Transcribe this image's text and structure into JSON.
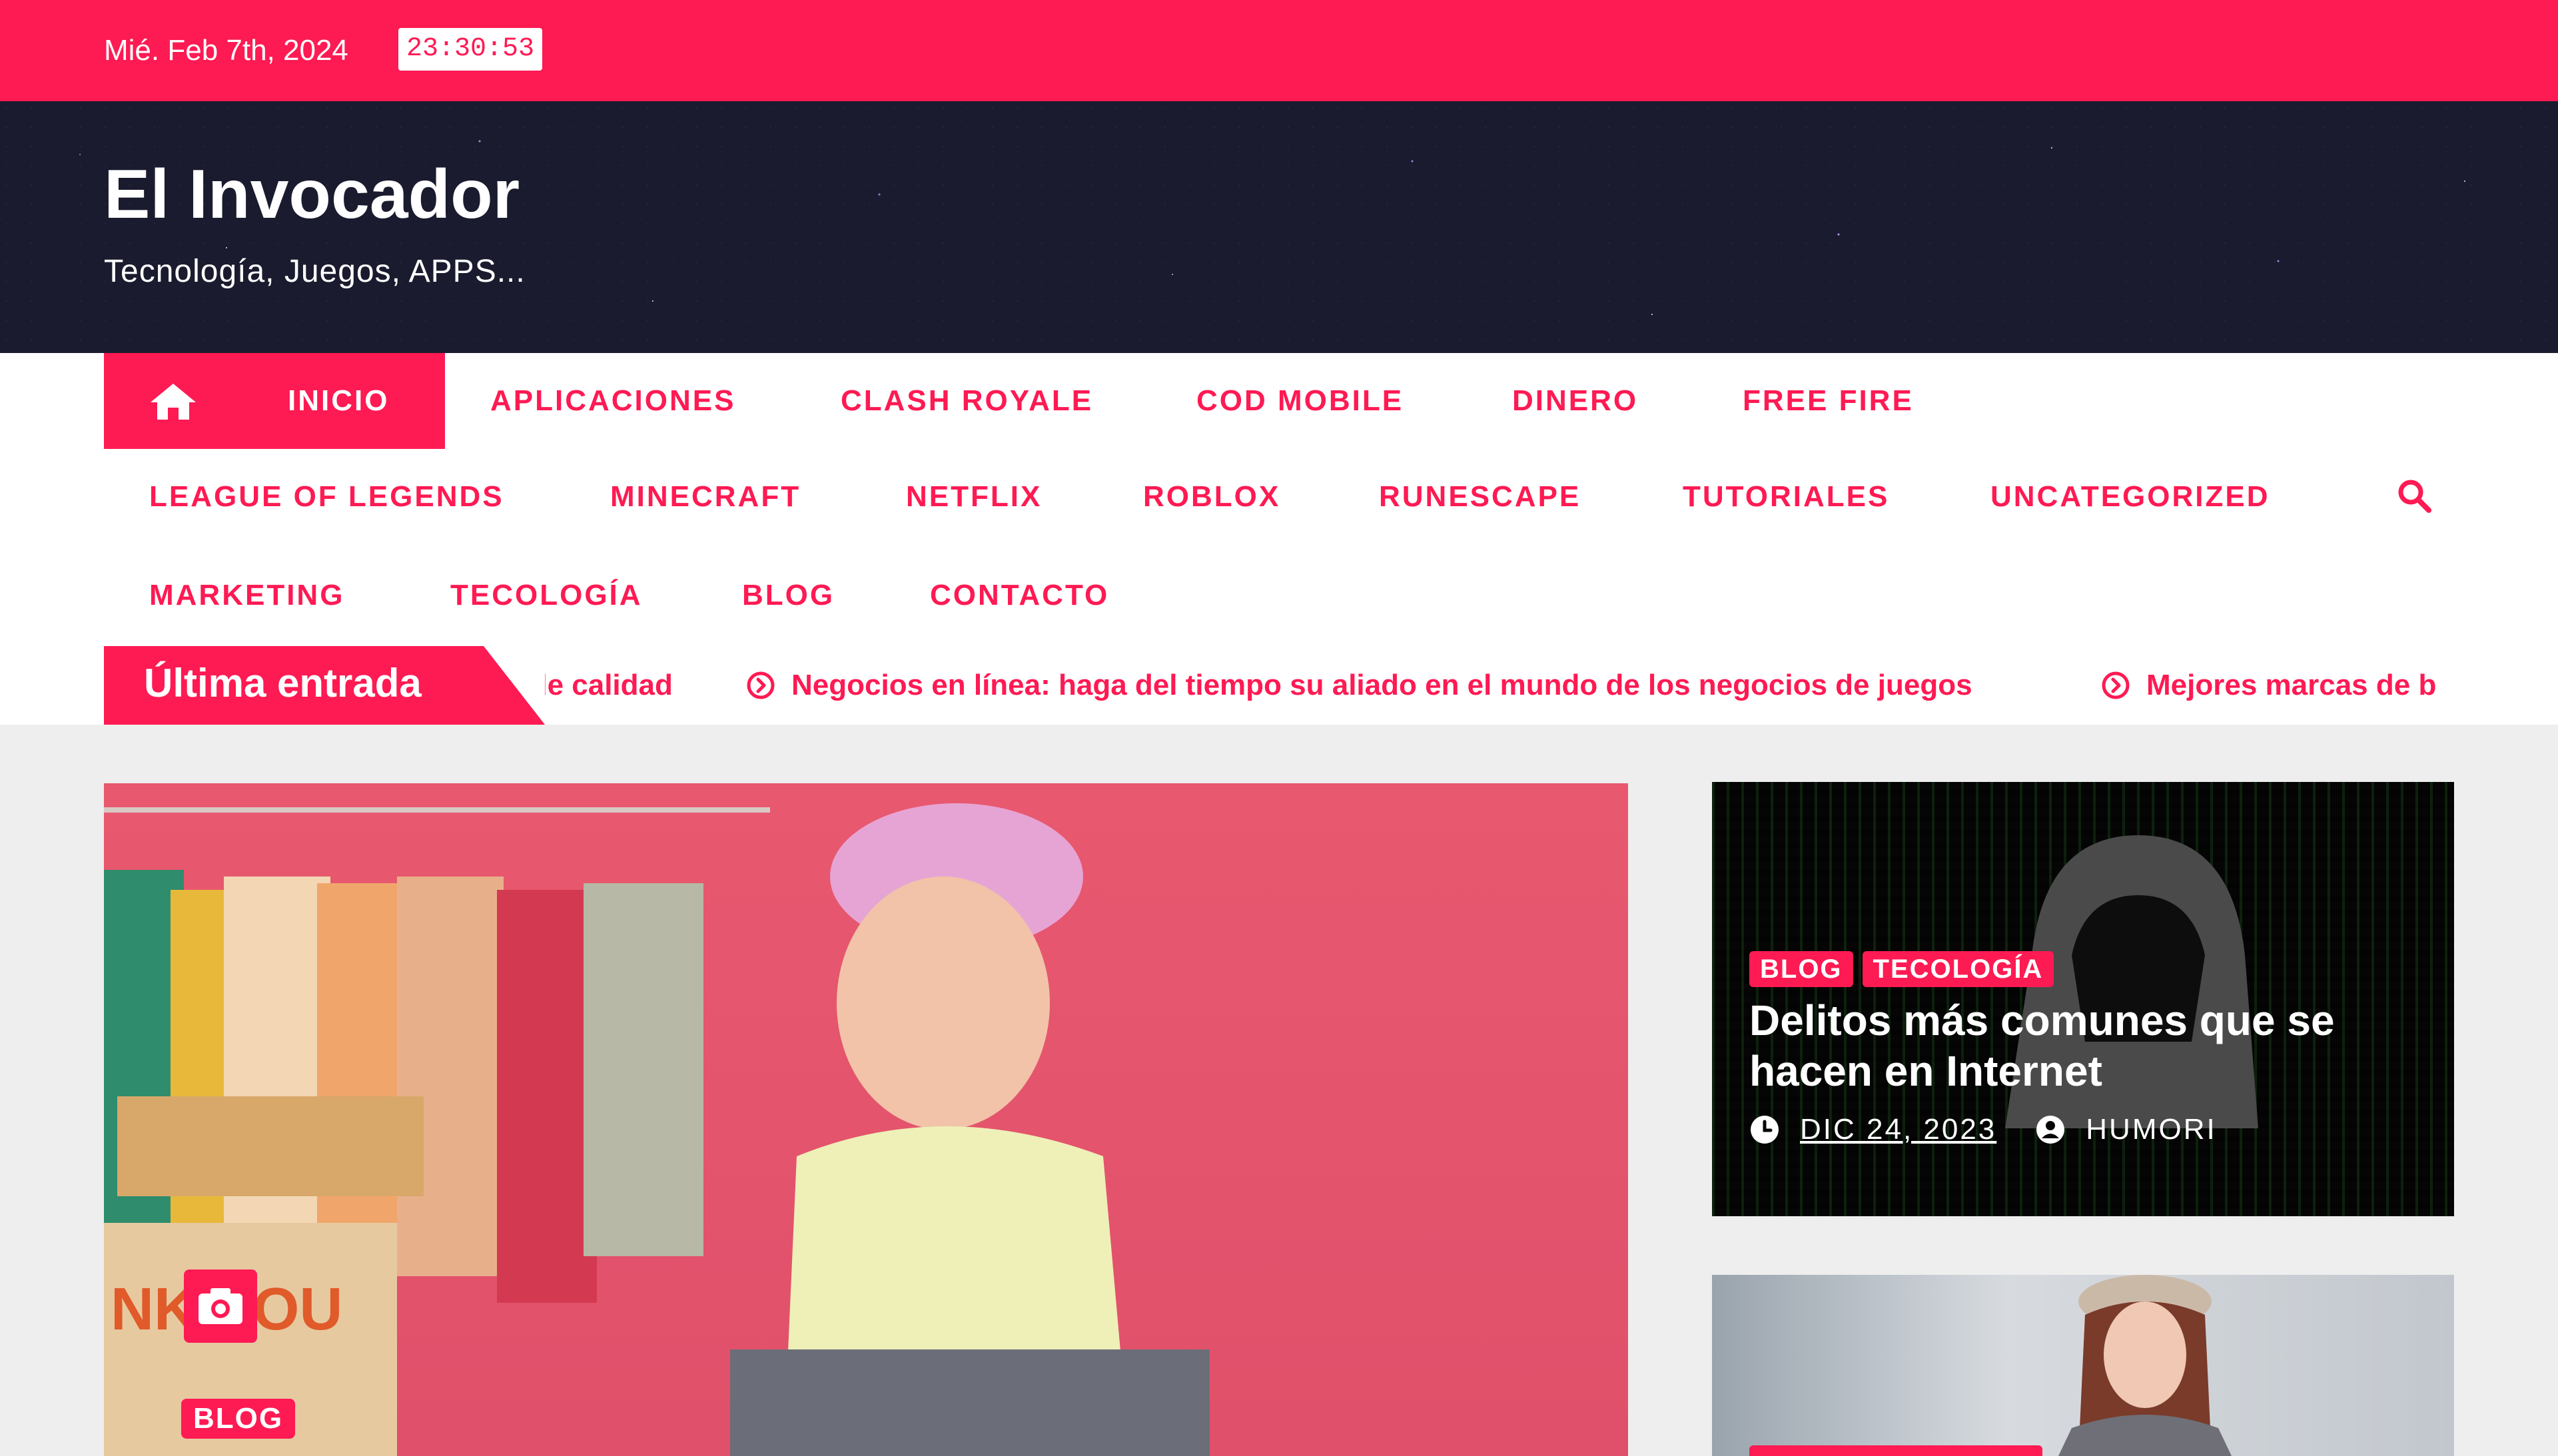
{
  "topbar": {
    "date": "Mié. Feb 7th, 2024",
    "time": "23:30:53"
  },
  "site": {
    "title": "El Invocador",
    "tagline": "Tecnología, Juegos, APPS..."
  },
  "nav": {
    "home_label": "INICIO",
    "items": [
      "APLICACIONES",
      "CLASH ROYALE",
      "COD MOBILE",
      "DINERO",
      "FREE FIRE",
      "LEAGUE OF LEGENDS",
      "MINECRAFT",
      "NETFLIX",
      "ROBLOX",
      "RUNESCAPE",
      "TUTORIALES",
      "UNCATEGORIZED",
      "MARKETING",
      "TECOLOGÍA",
      "BLOG",
      "CONTACTO"
    ]
  },
  "ticker": {
    "label": "Última entrada",
    "headlines": [
      "s de calidad",
      "Negocios en línea: haga del tiempo su aliado en el mundo de los negocios de juegos",
      "Mejores marcas de b"
    ]
  },
  "featured": {
    "category": "BLOG",
    "camera_icon": "camera-icon"
  },
  "side_post": {
    "categories": [
      "BLOG",
      "TECOLOGÍA"
    ],
    "title": "Delitos más comunes que se hacen en Internet",
    "date": "DIC 24, 2023",
    "author": "HUMORI"
  },
  "colors": {
    "accent": "#fe1a53",
    "header_bg": "#1a1b2e",
    "page_bg": "#eeeeee"
  }
}
